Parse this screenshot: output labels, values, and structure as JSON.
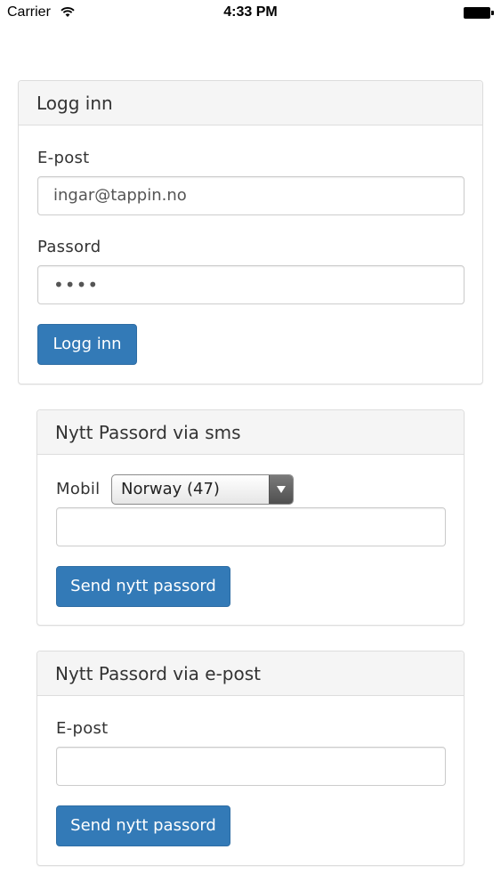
{
  "status_bar": {
    "carrier": "Carrier",
    "time": "4:33 PM"
  },
  "login": {
    "title": "Logg inn",
    "email_label": "E-post",
    "email_value": "ingar@tappin.no",
    "password_label": "Passord",
    "password_value": "••••",
    "submit_label": "Logg inn"
  },
  "sms_reset": {
    "title": "Nytt Passord via sms",
    "mobile_label": "Mobil",
    "country_selected": "Norway (47)",
    "phone_value": "",
    "submit_label": "Send nytt passord"
  },
  "email_reset": {
    "title": "Nytt Passord via e-post",
    "email_label": "E-post",
    "email_value": "",
    "submit_label": "Send nytt passord"
  }
}
